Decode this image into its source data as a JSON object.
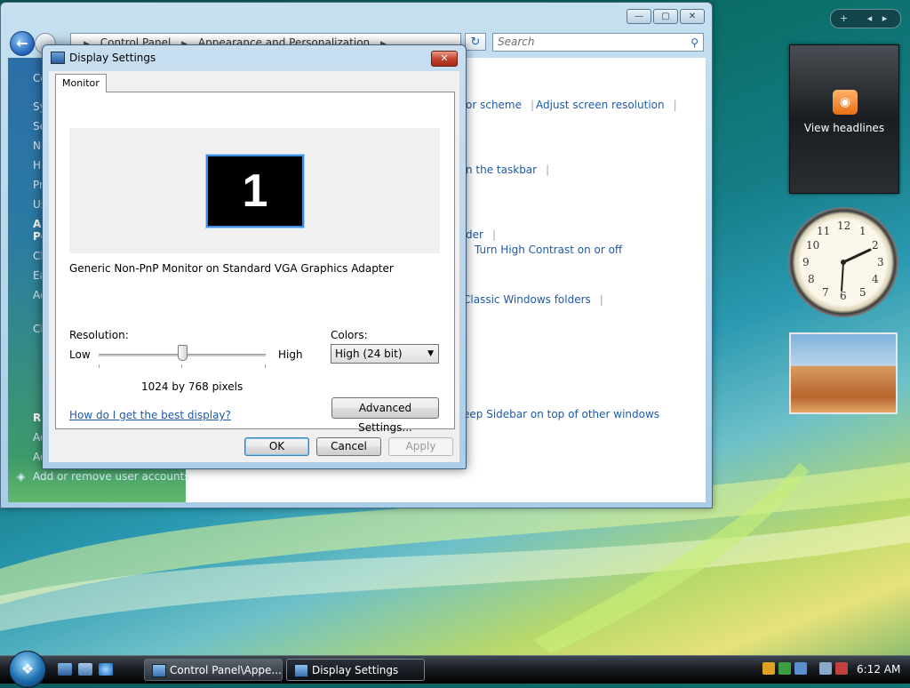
{
  "explorer": {
    "address": [
      "Control Panel",
      "Appearance and Personalization"
    ],
    "search_placeholder": "Search",
    "left_items": [
      "Co",
      "Sy",
      "Se",
      "Ne",
      "Ha",
      "Pr",
      "Us",
      "Ap",
      "Pe",
      "Cl",
      "Ea",
      "Ad",
      "Cl",
      "Re",
      "Ad",
      "Ad"
    ],
    "left_bottom_item": "Add or remove user accounts",
    "right_links": [
      "or scheme",
      "Adjust screen resolution",
      "n the taskbar",
      "der",
      "Turn High Contrast on or off",
      "Classic Windows folders",
      "eep Sidebar on top of other windows"
    ]
  },
  "dialog": {
    "title": "Display Settings",
    "tab": "Monitor",
    "monitor_number": "1",
    "monitor_name": "Generic Non-PnP Monitor on Standard VGA Graphics Adapter",
    "resolution_label": "Resolution:",
    "low": "Low",
    "high": "High",
    "resolution_value": "1024 by 768 pixels",
    "resolution_level": 0.5,
    "colors_label": "Colors:",
    "colors_value": "High (24 bit)",
    "help_link": "How do I get the best display?",
    "advanced_button": "Advanced Settings...",
    "ok": "OK",
    "cancel": "Cancel",
    "apply": "Apply"
  },
  "sidebar": {
    "feed_label": "View headlines",
    "clock_numbers": [
      "12",
      "1",
      "2",
      "3",
      "4",
      "5",
      "6",
      "7",
      "8",
      "9",
      "10",
      "11"
    ]
  },
  "taskbar": {
    "tasks": [
      "Control Panel\\Appe...",
      "Display Settings"
    ],
    "time": "6:12 AM"
  }
}
